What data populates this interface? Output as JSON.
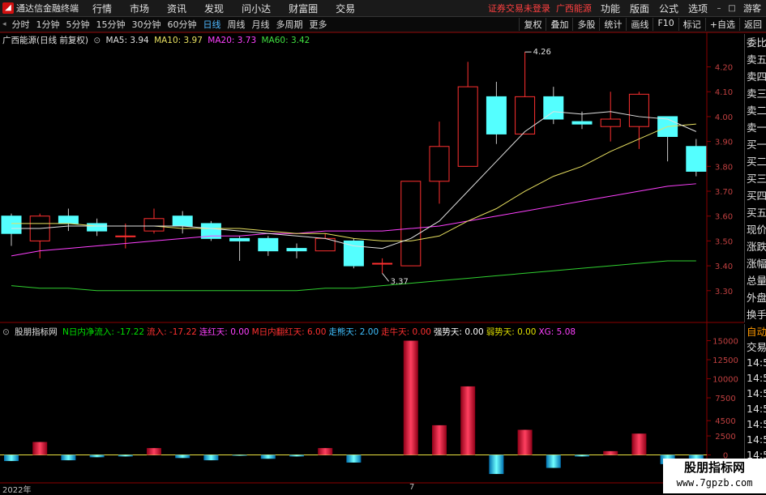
{
  "app": {
    "name": "通达信金融终端",
    "menu": [
      "行情",
      "市场",
      "资讯",
      "发现",
      "问小达",
      "财富圈",
      "交易"
    ],
    "status_text": "证券交易未登录",
    "stock_text": "广西能源",
    "right_menu": [
      "功能",
      "版面",
      "公式",
      "选项"
    ],
    "guest": "游客"
  },
  "periods": [
    "分时",
    "1分钟",
    "5分钟",
    "15分钟",
    "30分钟",
    "60分钟",
    "日线",
    "周线",
    "月线",
    "多周期",
    "更多"
  ],
  "active_period": "日线",
  "toolbar_right": [
    "复权",
    "叠加",
    "多股",
    "统计",
    "画线",
    "F10",
    "标记",
    "+自选",
    "返回"
  ],
  "main_info": {
    "title": "广西能源(日线 前复权)",
    "ma5": "MA5: 3.94",
    "ma10": "MA10: 3.97",
    "ma20": "MA20: 3.73",
    "ma60": "MA60: 3.42"
  },
  "indicator_info": {
    "name": "股朋指标网",
    "items": [
      {
        "text": "N日内净流入: -17.22",
        "color": "#00e000"
      },
      {
        "text": "流入: -17.22",
        "color": "#ff3030"
      },
      {
        "text": "连红天: 0.00",
        "color": "#ff40ff"
      },
      {
        "text": "M日内翻红天: 6.00",
        "color": "#ff3030"
      },
      {
        "text": "走熊天: 2.00",
        "color": "#40c0ff"
      },
      {
        "text": "走牛天: 0.00",
        "color": "#ff3030"
      },
      {
        "text": "强势天: 0.00",
        "color": "#ffffff"
      },
      {
        "text": "弱势天: 0.00",
        "color": "#e0e000"
      },
      {
        "text": "XG: 5.08",
        "color": "#ff40ff"
      }
    ]
  },
  "side_panel": [
    "委比",
    "卖五",
    "卖四",
    "卖三",
    "卖二",
    "卖一",
    "买一",
    "买二",
    "买三",
    "买四",
    "买五",
    "现价",
    "涨跌",
    "涨幅",
    "总量",
    "外盘",
    "换手",
    "净资",
    "收益"
  ],
  "side_panel2": [
    "自动",
    "交易",
    "14:5",
    "14:5",
    "14:5",
    "14:5",
    "14:5",
    "14:5",
    "14:5",
    "14:5"
  ],
  "time_axis": {
    "left": "2022年",
    "mid": "7"
  },
  "watermark": {
    "line1": "股朋指标网",
    "line2": "www.7gpzb.com"
  },
  "chart_data": [
    {
      "type": "candlestick",
      "ylim": [
        3.27,
        4.28
      ],
      "y_ticks": [
        "4.20",
        "4.10",
        "4.00",
        "3.90",
        "3.80",
        "3.70",
        "3.60",
        "3.50",
        "3.40",
        "3.30"
      ],
      "candles": [
        {
          "o": 3.6,
          "c": 3.53,
          "h": 3.61,
          "l": 3.48
        },
        {
          "o": 3.5,
          "c": 3.6,
          "h": 3.61,
          "l": 3.43
        },
        {
          "o": 3.6,
          "c": 3.57,
          "h": 3.63,
          "l": 3.54
        },
        {
          "o": 3.57,
          "c": 3.54,
          "h": 3.59,
          "l": 3.52
        },
        {
          "o": 3.52,
          "c": 3.52,
          "h": 3.57,
          "l": 3.47
        },
        {
          "o": 3.54,
          "c": 3.59,
          "h": 3.63,
          "l": 3.53
        },
        {
          "o": 3.6,
          "c": 3.56,
          "h": 3.62,
          "l": 3.53
        },
        {
          "o": 3.57,
          "c": 3.51,
          "h": 3.58,
          "l": 3.5
        },
        {
          "o": 3.51,
          "c": 3.5,
          "h": 3.52,
          "l": 3.42
        },
        {
          "o": 3.51,
          "c": 3.46,
          "h": 3.52,
          "l": 3.44
        },
        {
          "o": 3.47,
          "c": 3.46,
          "h": 3.49,
          "l": 3.43
        },
        {
          "o": 3.46,
          "c": 3.51,
          "h": 3.53,
          "l": 3.46
        },
        {
          "o": 3.5,
          "c": 3.4,
          "h": 3.51,
          "l": 3.39
        },
        {
          "o": 3.41,
          "c": 3.41,
          "h": 3.43,
          "l": 3.37
        },
        {
          "o": 3.4,
          "c": 3.74,
          "h": 3.74,
          "l": 3.4
        },
        {
          "o": 3.74,
          "c": 3.88,
          "h": 3.98,
          "l": 3.65
        },
        {
          "o": 3.8,
          "c": 4.12,
          "h": 4.22,
          "l": 3.8
        },
        {
          "o": 4.08,
          "c": 3.93,
          "h": 4.14,
          "l": 3.89
        },
        {
          "o": 3.93,
          "c": 4.08,
          "h": 4.26,
          "l": 3.93
        },
        {
          "o": 4.08,
          "c": 3.99,
          "h": 4.12,
          "l": 3.97
        },
        {
          "o": 3.98,
          "c": 3.97,
          "h": 4.02,
          "l": 3.95
        },
        {
          "o": 3.96,
          "c": 3.99,
          "h": 4.1,
          "l": 3.9
        },
        {
          "o": 3.96,
          "c": 4.09,
          "h": 4.1,
          "l": 3.87
        },
        {
          "o": 4.0,
          "c": 3.92,
          "h": 4.0,
          "l": 3.82
        },
        {
          "o": 3.88,
          "c": 3.78,
          "h": 3.91,
          "l": 3.76
        }
      ],
      "ma5": [
        3.55,
        3.55,
        3.56,
        3.56,
        3.56,
        3.56,
        3.56,
        3.55,
        3.54,
        3.53,
        3.52,
        3.51,
        3.48,
        3.47,
        3.51,
        3.58,
        3.7,
        3.82,
        3.94,
        4.02,
        4.01,
        4.02,
        4.0,
        3.99,
        3.94
      ],
      "ma10": [
        3.57,
        3.57,
        3.57,
        3.56,
        3.56,
        3.56,
        3.55,
        3.55,
        3.55,
        3.54,
        3.53,
        3.53,
        3.51,
        3.5,
        3.5,
        3.52,
        3.58,
        3.63,
        3.7,
        3.76,
        3.8,
        3.86,
        3.91,
        3.96,
        3.97
      ],
      "ma20": [
        3.44,
        3.46,
        3.47,
        3.48,
        3.49,
        3.5,
        3.51,
        3.52,
        3.52,
        3.53,
        3.53,
        3.54,
        3.54,
        3.54,
        3.55,
        3.56,
        3.58,
        3.6,
        3.62,
        3.64,
        3.66,
        3.68,
        3.7,
        3.72,
        3.73
      ],
      "ma60": [
        3.32,
        3.31,
        3.31,
        3.3,
        3.3,
        3.3,
        3.3,
        3.3,
        3.3,
        3.3,
        3.3,
        3.31,
        3.31,
        3.32,
        3.33,
        3.34,
        3.35,
        3.36,
        3.37,
        3.38,
        3.39,
        3.4,
        3.41,
        3.42,
        3.42
      ],
      "annotations": [
        {
          "index": 13,
          "label": "3.37"
        },
        {
          "index": 18,
          "label": "4.26"
        }
      ]
    },
    {
      "type": "bar",
      "ylim": [
        -2600,
        15800
      ],
      "y_ticks": [
        "15000",
        "12500",
        "10000",
        "7500",
        "4500",
        "2500",
        "0"
      ],
      "values": [
        -800,
        1700,
        -700,
        -300,
        -200,
        900,
        -400,
        -700,
        -100,
        -500,
        -200,
        900,
        -1000,
        0,
        15000,
        3900,
        9000,
        -2500,
        3300,
        -1700,
        -200,
        500,
        2800,
        -1200,
        -1100
      ]
    }
  ]
}
